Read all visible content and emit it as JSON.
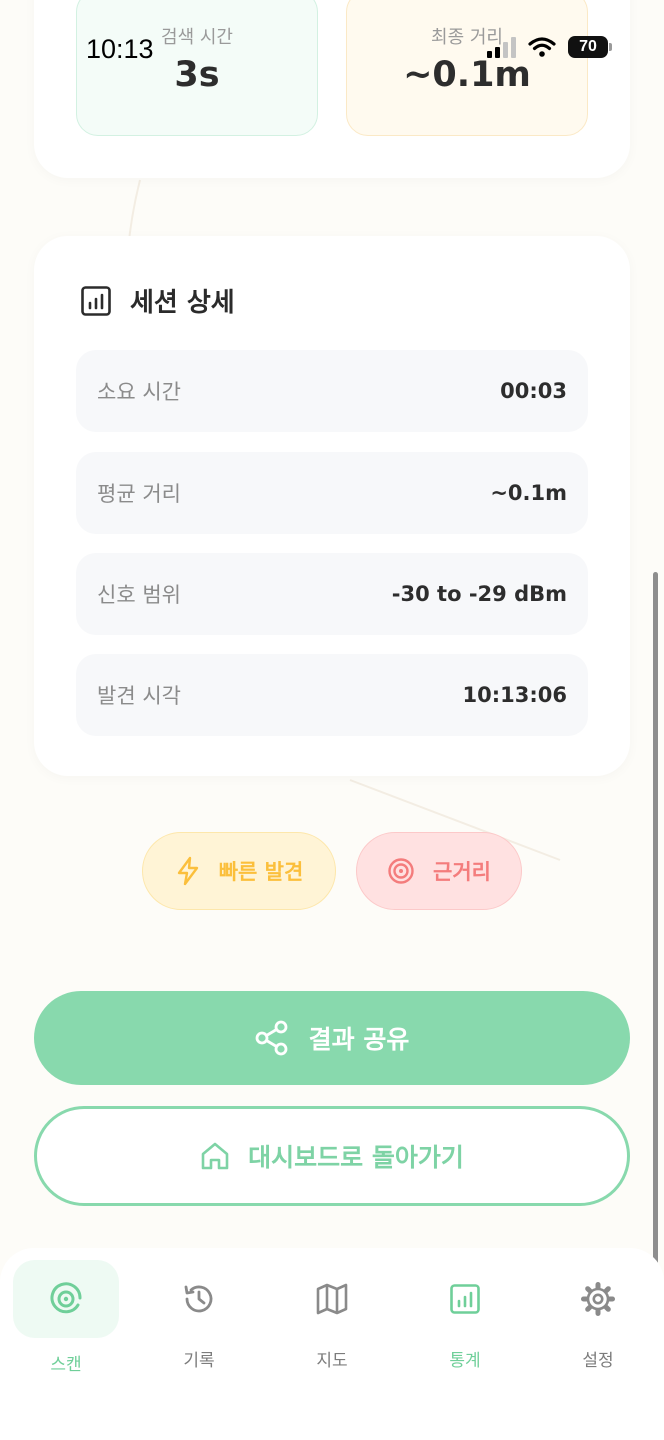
{
  "status_bar": {
    "time": "10:13",
    "battery": "70"
  },
  "top_stats": {
    "search_time": {
      "label": "검색 시간",
      "value": "3s"
    },
    "final_distance": {
      "label": "최종 거리",
      "value": "~0.1m"
    }
  },
  "session_detail": {
    "title": "세션 상세",
    "rows": [
      {
        "label": "소요 시간",
        "value": "00:03"
      },
      {
        "label": "평균 거리",
        "value": "~0.1m"
      },
      {
        "label": "신호 범위",
        "value": "-30 to -29 dBm"
      },
      {
        "label": "발견 시각",
        "value": "10:13:06"
      }
    ]
  },
  "badges": {
    "fast": "빠른 발견",
    "near": "근거리"
  },
  "actions": {
    "share": "결과 공유",
    "home": "대시보드로 돌아가기"
  },
  "nav": {
    "items": [
      {
        "label": "스캔",
        "icon": "radar-icon"
      },
      {
        "label": "기록",
        "icon": "history-icon"
      },
      {
        "label": "지도",
        "icon": "map-icon"
      },
      {
        "label": "통계",
        "icon": "chart-icon"
      },
      {
        "label": "설정",
        "icon": "gear-icon"
      }
    ]
  },
  "colors": {
    "accent_green": "#88d9ad",
    "badge_yellow": "#fbbf3c",
    "badge_red": "#f47c7c"
  }
}
